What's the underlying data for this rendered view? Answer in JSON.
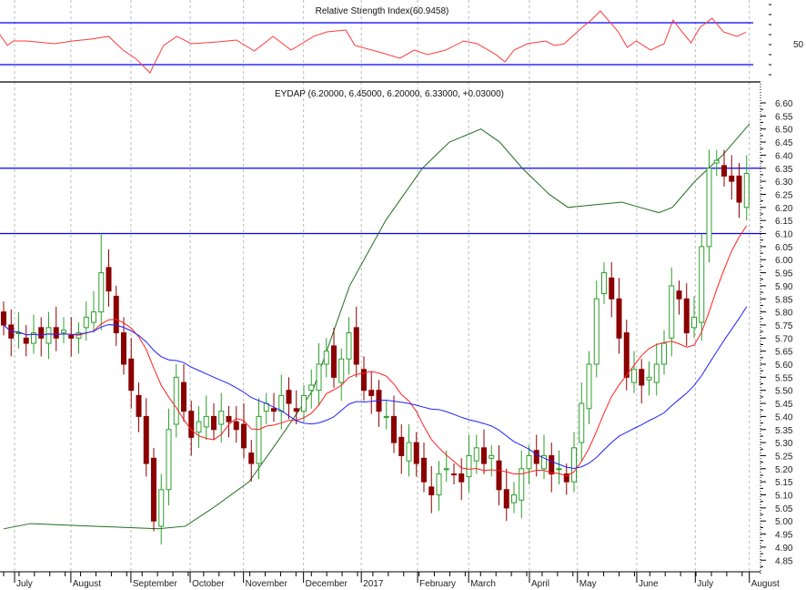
{
  "chart_data": {
    "type": "candlestick",
    "rsi_panel": {
      "title": "Relative Strength Index(60.9458)",
      "axis_label": "50",
      "levels": [
        70,
        30
      ],
      "range": [
        10,
        90
      ],
      "line_color": "#ff3b3b",
      "level_color": "#0000ff",
      "points": [
        [
          0,
          58.7
        ],
        [
          1,
          48.3
        ],
        [
          1.8,
          52.6
        ],
        [
          3.6,
          52.6
        ],
        [
          7.3,
          50
        ],
        [
          9.7,
          52.6
        ],
        [
          12.1,
          54.3
        ],
        [
          14.5,
          57
        ],
        [
          16.4,
          43.9
        ],
        [
          18.2,
          35.2
        ],
        [
          20,
          22.2
        ],
        [
          21.8,
          48.3
        ],
        [
          23.6,
          57
        ],
        [
          25.5,
          50
        ],
        [
          29.1,
          51.7
        ],
        [
          31.5,
          53.5
        ],
        [
          33.9,
          43
        ],
        [
          36.4,
          57
        ],
        [
          38.8,
          43.9
        ],
        [
          41.8,
          57
        ],
        [
          43.6,
          61.3
        ],
        [
          46.1,
          63
        ],
        [
          47.3,
          48.3
        ],
        [
          50.9,
          41.3
        ],
        [
          53.3,
          36.1
        ],
        [
          55.2,
          43.9
        ],
        [
          57,
          39.6
        ],
        [
          59.4,
          43.9
        ],
        [
          61.8,
          52.6
        ],
        [
          63.6,
          50
        ],
        [
          66.1,
          39.6
        ],
        [
          67.3,
          32.6
        ],
        [
          68.5,
          43.9
        ],
        [
          70.3,
          50
        ],
        [
          72.7,
          52.6
        ],
        [
          73.9,
          48.3
        ],
        [
          75.2,
          50
        ],
        [
          77.6,
          65.7
        ],
        [
          78.8,
          72.6
        ],
        [
          80,
          81.3
        ],
        [
          82.4,
          61.3
        ],
        [
          83.6,
          46.5
        ],
        [
          84.8,
          52.6
        ],
        [
          86.7,
          43.9
        ],
        [
          88.5,
          50
        ],
        [
          89.7,
          72.6
        ],
        [
          90.9,
          61.3
        ],
        [
          92.1,
          50.9
        ],
        [
          93.3,
          65.7
        ],
        [
          94.9,
          74.3
        ],
        [
          96.4,
          61.3
        ],
        [
          98.2,
          57
        ],
        [
          99.4,
          60.9
        ]
      ]
    },
    "price_panel": {
      "title": "EYDAP (6.20000, 6.45000, 6.20000, 6.33000, +0.03000)",
      "ylim": [
        4.82,
        6.66
      ],
      "yticks": [
        "6.60",
        "6.55",
        "6.50",
        "6.45",
        "6.40",
        "6.35",
        "6.30",
        "6.25",
        "6.20",
        "6.15",
        "6.10",
        "6.05",
        "6.00",
        "5.95",
        "5.90",
        "5.85",
        "5.80",
        "5.75",
        "5.70",
        "5.65",
        "5.60",
        "5.55",
        "5.50",
        "5.45",
        "5.40",
        "5.35",
        "5.30",
        "5.25",
        "5.20",
        "5.15",
        "5.10",
        "5.05",
        "5.00",
        "4.95",
        "4.90",
        "4.85"
      ],
      "horizontal_lines": [
        6.35,
        6.1
      ],
      "line_color": "#0000ff",
      "up_color": "#2ca02c",
      "down_color": "#8b0000",
      "first_open": 5.8,
      "spike": {
        "index": 13,
        "high": 6.1
      },
      "close": [
        5.75,
        5.7,
        5.72,
        5.68,
        5.72,
        5.7,
        5.74,
        5.7,
        5.73,
        5.7,
        5.72,
        5.78,
        5.8,
        5.95,
        5.88,
        5.72,
        5.6,
        5.5,
        5.4,
        5.22,
        5.0,
        5.12,
        5.35,
        5.55,
        5.42,
        5.32,
        5.38,
        5.4,
        5.35,
        5.42,
        5.38,
        5.35,
        5.28,
        5.22,
        5.4,
        5.45,
        5.42,
        5.48,
        5.45,
        5.42,
        5.48,
        5.52,
        5.6,
        5.65,
        5.55,
        5.62,
        5.72,
        5.6,
        5.5,
        5.48,
        5.42,
        5.4,
        5.3,
        5.25,
        5.3,
        5.22,
        5.15,
        5.1,
        5.18,
        5.2,
        5.18,
        5.15,
        5.25,
        5.28,
        5.22,
        5.25,
        5.12,
        5.05,
        5.1,
        5.2,
        5.25,
        5.22,
        5.25,
        5.18,
        5.2,
        5.15,
        5.28,
        5.45,
        5.6,
        5.85,
        5.95,
        5.85,
        5.7,
        5.55,
        5.58,
        5.52,
        5.55,
        5.6,
        5.68,
        5.9,
        5.85,
        5.72,
        5.78,
        6.05,
        6.35,
        6.38,
        6.32,
        6.3,
        6.22,
        6.33
      ],
      "ma_short": {
        "period": 10,
        "color": "#ff2020"
      },
      "ma_medium": {
        "period": 25,
        "color": "#2020ff"
      },
      "ma_long": {
        "color": "#1f6f1f",
        "points": [
          [
            0,
            4.97
          ],
          [
            3.6,
            4.99
          ],
          [
            12.1,
            4.98
          ],
          [
            20.6,
            4.97
          ],
          [
            24.2,
            4.98
          ],
          [
            27.9,
            5.05
          ],
          [
            32.7,
            5.15
          ],
          [
            36.4,
            5.3
          ],
          [
            41.2,
            5.5
          ],
          [
            46.1,
            5.9
          ],
          [
            50.9,
            6.15
          ],
          [
            55.8,
            6.35
          ],
          [
            59.4,
            6.45
          ],
          [
            63.6,
            6.5
          ],
          [
            66.1,
            6.45
          ],
          [
            69.1,
            6.35
          ],
          [
            72.7,
            6.25
          ],
          [
            75.2,
            6.2
          ],
          [
            78.8,
            6.21
          ],
          [
            82.4,
            6.22
          ],
          [
            84.8,
            6.2
          ],
          [
            87.3,
            6.18
          ],
          [
            89.1,
            6.2
          ],
          [
            92.1,
            6.3
          ],
          [
            95.8,
            6.4
          ],
          [
            99.4,
            6.52
          ]
        ]
      }
    },
    "xaxis": {
      "ticks": [
        {
          "t": 1.7,
          "label": "July"
        },
        {
          "t": 9.2,
          "label": "August"
        },
        {
          "t": 17.2,
          "label": "September"
        },
        {
          "t": 25.1,
          "label": "October"
        },
        {
          "t": 32.2,
          "label": "November"
        },
        {
          "t": 40.2,
          "label": "December"
        },
        {
          "t": 47.9,
          "label": "2017"
        },
        {
          "t": 55.4,
          "label": "February"
        },
        {
          "t": 62.2,
          "label": "March"
        },
        {
          "t": 70.3,
          "label": "April"
        },
        {
          "t": 76.7,
          "label": "May"
        },
        {
          "t": 84.6,
          "label": "June"
        },
        {
          "t": 92.4,
          "label": "July"
        },
        {
          "t": 99.6,
          "label": "August"
        }
      ]
    }
  }
}
